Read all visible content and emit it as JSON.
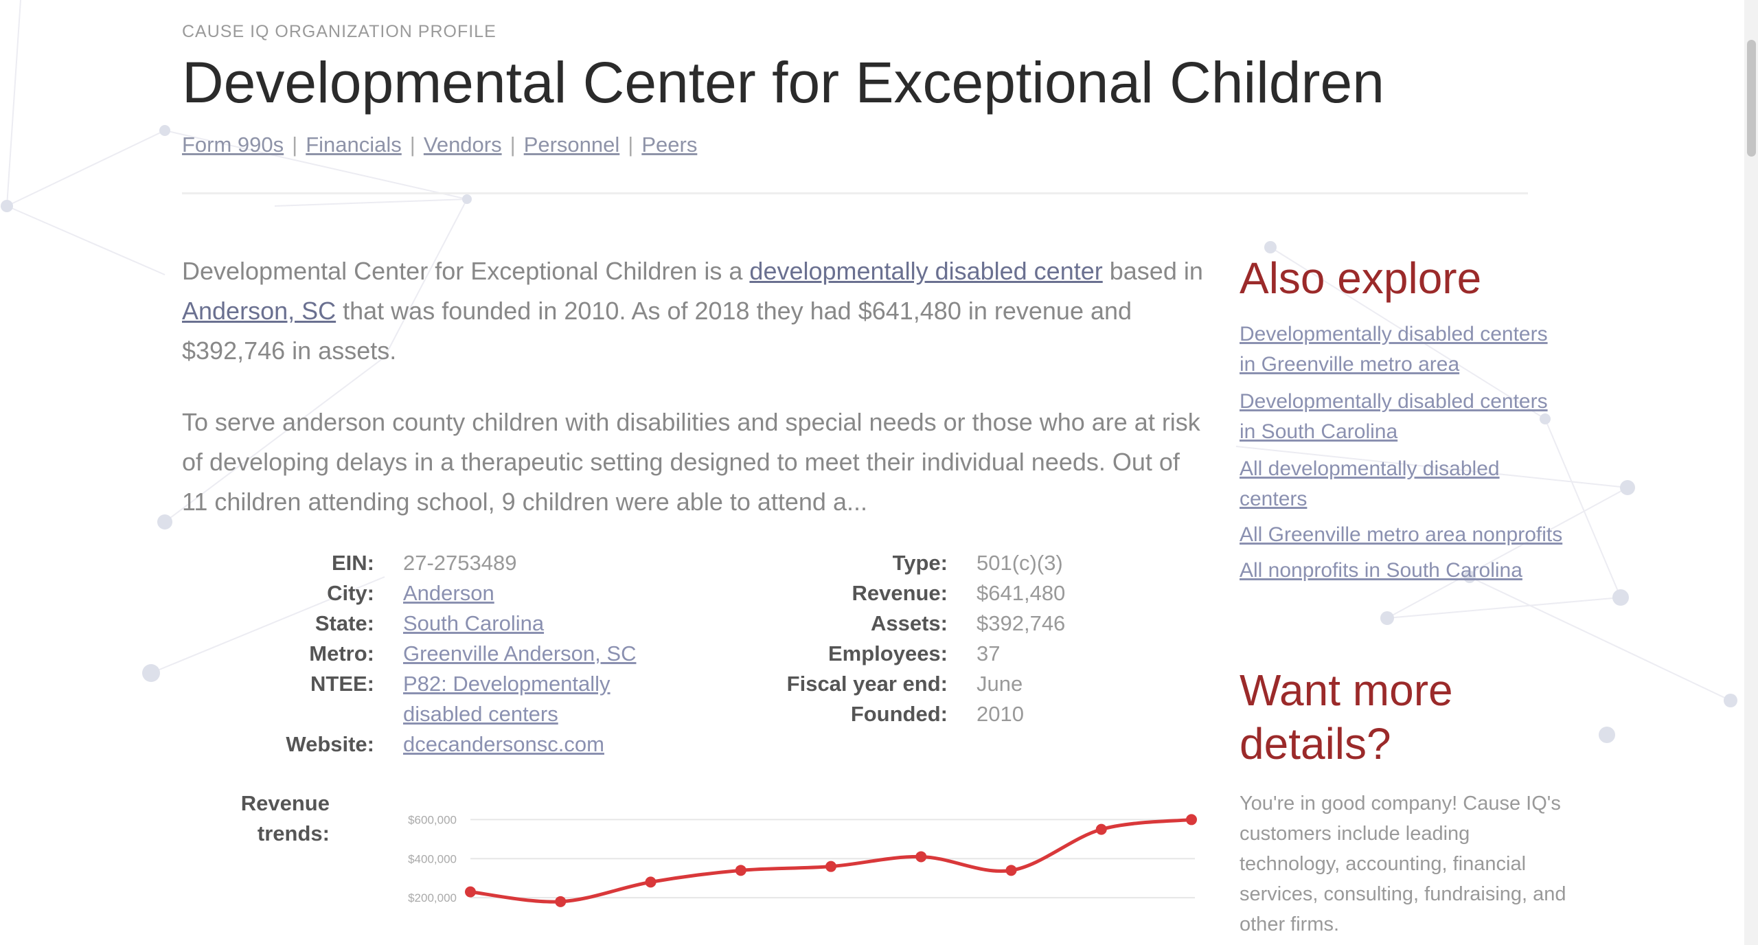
{
  "header": {
    "eyebrow": "CAUSE IQ ORGANIZATION PROFILE",
    "title": "Developmental Center for Exceptional Children",
    "nav": [
      "Form 990s",
      "Financials",
      "Vendors",
      "Personnel",
      "Peers"
    ]
  },
  "description": {
    "p1_a": "Developmental Center for Exceptional Children is a ",
    "p1_link1": "developmentally disabled center",
    "p1_b": " based in ",
    "p1_link2": "Anderson, SC",
    "p1_c": " that was founded in 2010. As of 2018 they had $641,480 in revenue and $392,746 in assets.",
    "p2": "To serve anderson county children with disabilities and special needs or those who are at risk of developing delays in a therapeutic setting designed to meet their individual needs. Out of 11 children attending school, 9 children were able to attend a..."
  },
  "facts_left": {
    "ein_label": "EIN:",
    "ein": "27-2753489",
    "city_label": "City:",
    "city": "Anderson",
    "state_label": "State:",
    "state": "South Carolina",
    "metro_label": "Metro:",
    "metro": "Greenville Anderson, SC",
    "ntee_label": "NTEE:",
    "ntee": "P82: Developmentally disabled centers",
    "website_label": "Website:",
    "website": "dcecandersonsc.com"
  },
  "facts_right": {
    "type_label": "Type:",
    "type": "501(c)(3)",
    "revenue_label": "Revenue:",
    "revenue": "$641,480",
    "assets_label": "Assets:",
    "assets": "$392,746",
    "employees_label": "Employees:",
    "employees": "37",
    "fye_label": "Fiscal year end:",
    "fye": "June",
    "founded_label": "Founded:",
    "founded": "2010"
  },
  "trend_label": "Revenue trends:",
  "chart_data": {
    "type": "line",
    "title": "",
    "xlabel": "",
    "ylabel": "",
    "y_ticks": [
      "$600,000",
      "$400,000",
      "$200,000"
    ],
    "y_tick_values": [
      600000,
      400000,
      200000
    ],
    "ylim": [
      0,
      700000
    ],
    "grid": true,
    "legend": "none",
    "series": [
      {
        "values": [
          230000,
          180000,
          280000,
          340000,
          360000,
          410000,
          340000,
          550000,
          600000
        ]
      }
    ],
    "color": "#d9383a"
  },
  "sidebar": {
    "also_heading": "Also explore",
    "links": [
      "Developmentally disabled centers in Greenville metro area",
      "Developmentally disabled centers in South Carolina",
      "All developmentally disabled centers",
      "All Greenville metro area nonprofits",
      "All nonprofits in South Carolina"
    ],
    "more_heading": "Want more details?",
    "more_text": "You're in good company! Cause IQ's customers include leading technology, accounting, financial services, consulting, fundraising, and other firms."
  },
  "colors": {
    "accent": "#9b2a2a",
    "link": "#8a90b0",
    "chart_line": "#d9383a"
  }
}
